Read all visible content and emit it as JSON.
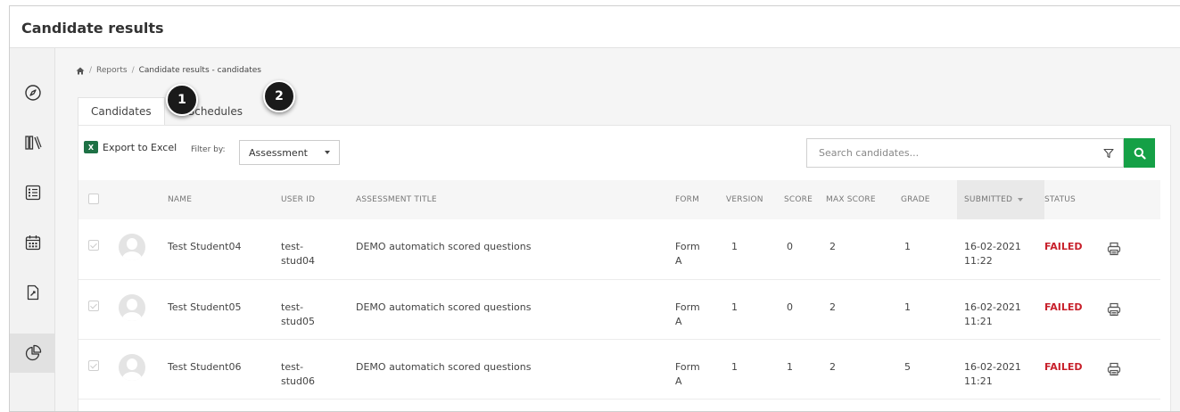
{
  "header": {
    "title": "Candidate results"
  },
  "breadcrumb": {
    "home_icon": "home-icon",
    "reports": "Reports",
    "current": "Candidate results - candidates"
  },
  "tabs": [
    {
      "label": "Candidates",
      "active": true
    },
    {
      "label": "Schedules",
      "active": false
    }
  ],
  "markers": [
    "1",
    "2"
  ],
  "toolbar": {
    "export_label": "Export to Excel",
    "filter_label": "Filter by:",
    "filter_value": "Assessment"
  },
  "search": {
    "placeholder": "Search candidates...",
    "value": ""
  },
  "sidebar": {
    "items": [
      "compass-icon",
      "library-icon",
      "list-icon",
      "calendar-icon",
      "document-edit-icon",
      "pie-chart-icon"
    ],
    "active_index": 5
  },
  "table": {
    "headers": {
      "name": "NAME",
      "user_id": "USER ID",
      "assessment_title": "ASSESSMENT TITLE",
      "form": "FORM",
      "version": "VERSION",
      "score": "SCORE",
      "max_score": "MAX SCORE",
      "grade": "GRADE",
      "submitted": "SUBMITTED",
      "status": "STATUS"
    },
    "rows": [
      {
        "name": "Test Student04",
        "user_id": [
          "test-",
          "stud04"
        ],
        "assessment_title": "DEMO automatich scored questions",
        "form": [
          "Form",
          "A"
        ],
        "version": "1",
        "score": "0",
        "max_score": "2",
        "grade": "1",
        "submitted": [
          "16-02-2021",
          "11:22"
        ],
        "status": "FAILED"
      },
      {
        "name": "Test Student05",
        "user_id": [
          "test-",
          "stud05"
        ],
        "assessment_title": "DEMO automatich scored questions",
        "form": [
          "Form",
          "A"
        ],
        "version": "1",
        "score": "0",
        "max_score": "2",
        "grade": "1",
        "submitted": [
          "16-02-2021",
          "11:21"
        ],
        "status": "FAILED"
      },
      {
        "name": "Test Student06",
        "user_id": [
          "test-",
          "stud06"
        ],
        "assessment_title": "DEMO automatich scored questions",
        "form": [
          "Form",
          "A"
        ],
        "version": "1",
        "score": "1",
        "max_score": "2",
        "grade": "5",
        "submitted": [
          "16-02-2021",
          "11:21"
        ],
        "status": "FAILED"
      }
    ]
  },
  "colors": {
    "accent_green": "#15a046",
    "status_failed": "#c8202b",
    "excel_green": "#1e7145"
  }
}
